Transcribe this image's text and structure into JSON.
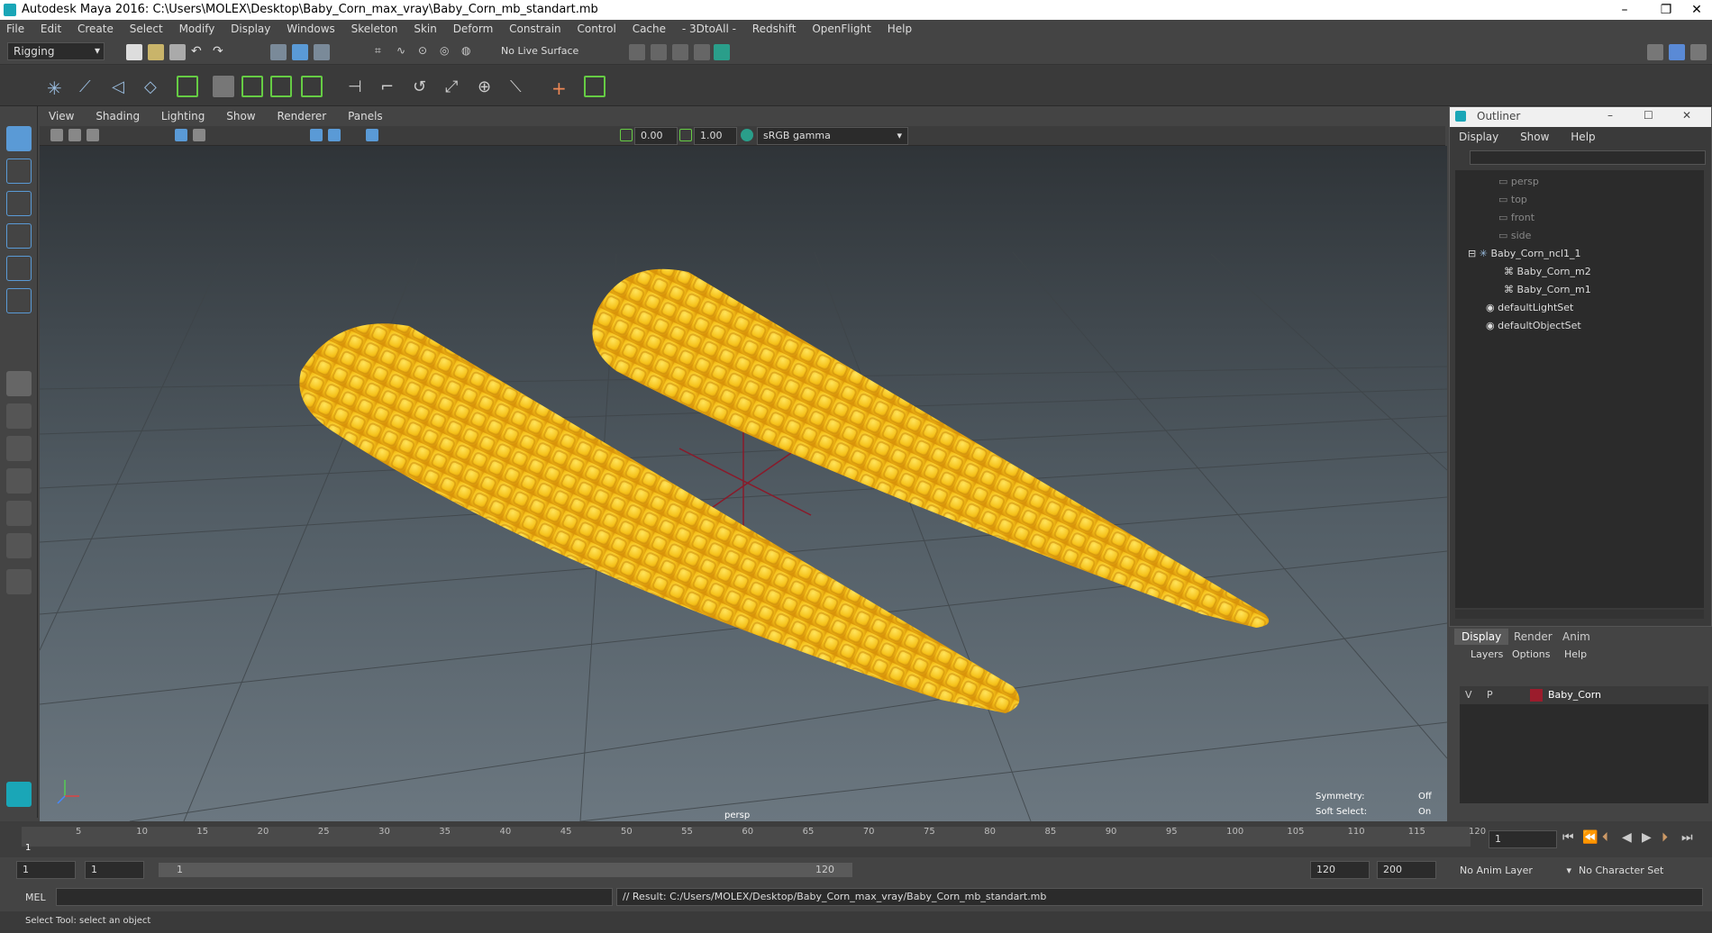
{
  "window": {
    "title": "Autodesk Maya 2016: C:\\Users\\MOLEX\\Desktop\\Baby_Corn_max_vray\\Baby_Corn_mb_standart.mb",
    "min": "–",
    "max": "❐",
    "close": "✕"
  },
  "menubar": [
    "File",
    "Edit",
    "Create",
    "Select",
    "Modify",
    "Display",
    "Windows",
    "Skeleton",
    "Skin",
    "Deform",
    "Constrain",
    "Control",
    "Cache",
    "- 3DtoAll -",
    "Redshift",
    "OpenFlight",
    "Help"
  ],
  "shelf": {
    "mode_select": "Rigging",
    "live_surface": "No Live Surface"
  },
  "viewport": {
    "menu": [
      "View",
      "Shading",
      "Lighting",
      "Show",
      "Renderer",
      "Panels"
    ],
    "exposure": "0.00",
    "gamma": "1.00",
    "color_space": "sRGB gamma",
    "camera_label": "persp",
    "hud": {
      "symmetry_label": "Symmetry:",
      "symmetry_value": "Off",
      "soft_select_label": "Soft Select:",
      "soft_select_value": "On"
    }
  },
  "outliner": {
    "title": "Outliner",
    "menu": [
      "Display",
      "Show",
      "Help"
    ],
    "items": [
      {
        "label": "persp",
        "icon": "camera-icon",
        "dim": true
      },
      {
        "label": "top",
        "icon": "camera-icon",
        "dim": true
      },
      {
        "label": "front",
        "icon": "camera-icon",
        "dim": true
      },
      {
        "label": "side",
        "icon": "camera-icon",
        "dim": true
      },
      {
        "label": "Baby_Corn_ncl1_1",
        "icon": "group-icon",
        "dim": false
      },
      {
        "label": "Baby_Corn_m2",
        "icon": "mesh-icon",
        "dim": false
      },
      {
        "label": "Baby_Corn_m1",
        "icon": "mesh-icon",
        "dim": false
      },
      {
        "label": "defaultLightSet",
        "icon": "set-icon",
        "dim": false
      },
      {
        "label": "defaultObjectSet",
        "icon": "set-icon",
        "dim": false
      }
    ]
  },
  "layers": {
    "tabs": [
      "Display",
      "Render",
      "Anim"
    ],
    "menu": [
      "Layers",
      "Options",
      "Help"
    ],
    "layer": {
      "v": "V",
      "p": "P",
      "name": "Baby_Corn",
      "color": "#9b1c2c"
    }
  },
  "timeline": {
    "ticks": [
      "5",
      "10",
      "15",
      "20",
      "25",
      "30",
      "35",
      "40",
      "45",
      "50",
      "55",
      "60",
      "65",
      "70",
      "75",
      "80",
      "85",
      "90",
      "95",
      "100",
      "105",
      "110",
      "115",
      "120"
    ],
    "current_frame": "1",
    "frame_field": "1"
  },
  "range": {
    "start": "1",
    "start2": "1",
    "slider_start": "1",
    "slider_end": "120",
    "end": "120",
    "end2": "200",
    "anim_layer": "No Anim Layer",
    "char_set": "No Character Set"
  },
  "cmd": {
    "lang": "MEL",
    "result": "// Result: C:/Users/MOLEX/Desktop/Baby_Corn_max_vray/Baby_Corn_mb_standart.mb"
  },
  "status": "Select Tool: select an object"
}
